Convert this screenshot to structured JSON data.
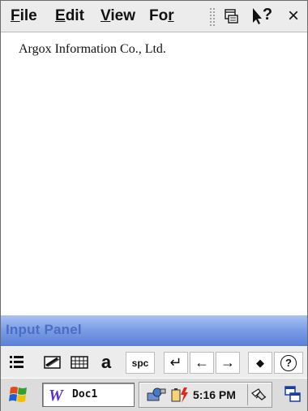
{
  "menu": {
    "file": "File",
    "file_u": "F",
    "file_rest": "ile",
    "edit_u": "E",
    "edit_rest": "dit",
    "view_u": "V",
    "view_rest": "iew",
    "format_pre": "Fo",
    "format_u": "r",
    "toolbar_icons": [
      "keyboard-window-icon",
      "help-icon",
      "close-icon"
    ],
    "close_label": "×",
    "help_label": "?"
  },
  "document": {
    "text": "Argox Information Co., Ltd."
  },
  "input_panel": {
    "title": "Input Panel",
    "buttons": [
      {
        "name": "list-icon"
      },
      {
        "name": "handwriting-icon"
      },
      {
        "name": "keyboard-grid-icon"
      },
      {
        "name": "letter-a-icon",
        "label": "a"
      },
      {
        "name": "space-key",
        "label": "spc"
      },
      {
        "name": "enter-key",
        "label": "↵"
      },
      {
        "name": "arrow-left-key",
        "label": "←"
      },
      {
        "name": "arrow-right-key",
        "label": "→"
      },
      {
        "name": "bullet-key",
        "label": "◆"
      },
      {
        "name": "help-key",
        "label": "?"
      }
    ]
  },
  "taskbar": {
    "task_label": "Doc1",
    "clock": "5:16 PM"
  },
  "colors": {
    "input_panel_title": "#4c6dc4",
    "input_panel_bar": "#7c9ee6"
  }
}
